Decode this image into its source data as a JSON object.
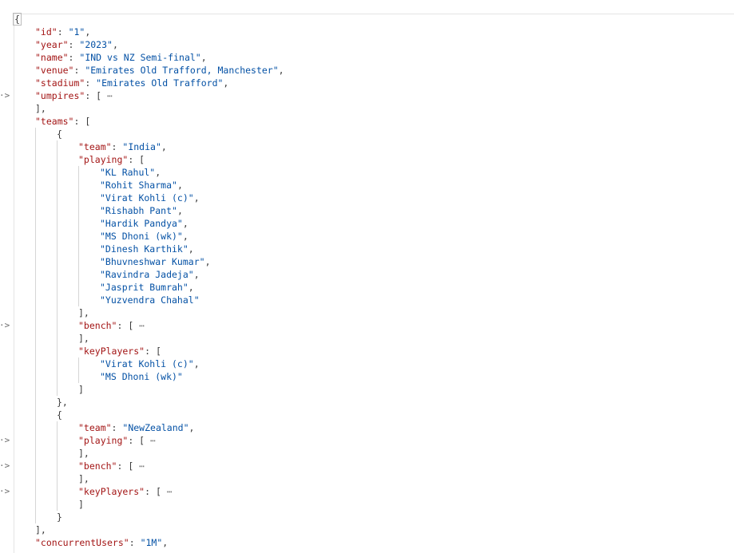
{
  "editor": {
    "fold_marker": "·>",
    "ellipsis": "⋯"
  },
  "json": {
    "id": "1",
    "year": "2023",
    "name": "IND vs NZ Semi-final",
    "venue": "Emirates Old Trafford, Manchester",
    "stadium": "Emirates Old Trafford",
    "umpires_key": "umpires",
    "teams_key": "teams",
    "teams": [
      {
        "team": "India",
        "playing": [
          "KL Rahul",
          "Rohit Sharma",
          "Virat Kohli (c)",
          "Rishabh Pant",
          "Hardik Pandya",
          "MS Dhoni (wk)",
          "Dinesh Karthik",
          "Bhuvneshwar Kumar",
          "Ravindra Jadeja",
          "Jasprit Bumrah",
          "Yuzvendra Chahal"
        ],
        "keyPlayers": [
          "Virat Kohli (c)",
          "MS Dhoni (wk)"
        ]
      },
      {
        "team": "NewZealand"
      }
    ],
    "concurrentUsers": "1M"
  }
}
